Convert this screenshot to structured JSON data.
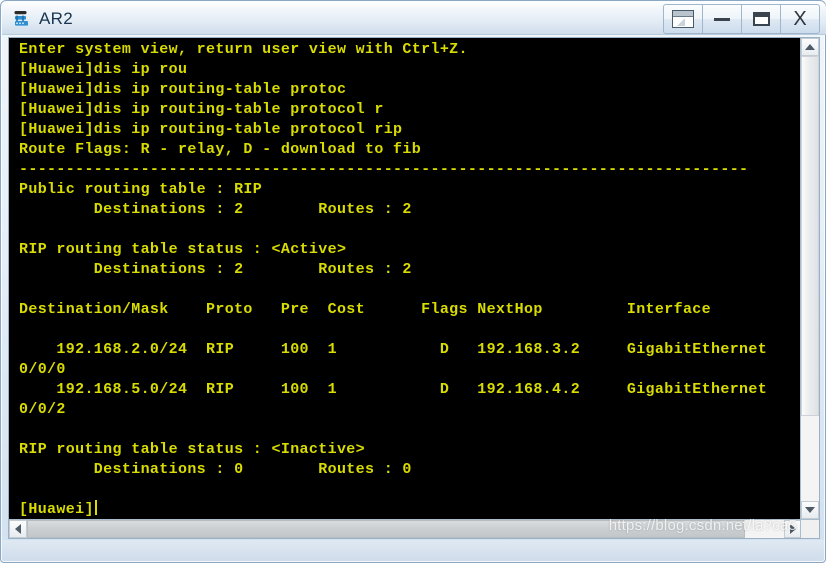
{
  "window": {
    "title": "AR2",
    "icon": "router-icon",
    "controls": [
      {
        "name": "restore-window-button",
        "icon": "restore-icon",
        "label": ""
      },
      {
        "name": "minimize-button",
        "icon": "minimize-icon",
        "label": ""
      },
      {
        "name": "maximize-button",
        "icon": "maximize-icon",
        "label": ""
      },
      {
        "name": "close-button",
        "icon": "close-icon",
        "label": "X"
      }
    ]
  },
  "terminal": {
    "foreground_color": "#d9dc00",
    "background_color": "#000000",
    "lines": [
      "Enter system view, return user view with Ctrl+Z.",
      "[Huawei]dis ip rou",
      "[Huawei]dis ip routing-table protoc",
      "[Huawei]dis ip routing-table protocol r",
      "[Huawei]dis ip routing-table protocol rip",
      "Route Flags: R - relay, D - download to fib",
      "------------------------------------------------------------------------------",
      "Public routing table : RIP",
      "        Destinations : 2        Routes : 2",
      "",
      "RIP routing table status : <Active>",
      "        Destinations : 2        Routes : 2",
      "",
      "Destination/Mask    Proto   Pre  Cost      Flags NextHop         Interface",
      "",
      "    192.168.2.0/24  RIP     100  1           D   192.168.3.2     GigabitEthernet",
      "0/0/0",
      "    192.168.5.0/24  RIP     100  1           D   192.168.4.2     GigabitEthernet",
      "0/0/2",
      "",
      "RIP routing table status : <Inactive>",
      "        Destinations : 0        Routes : 0",
      "",
      "[Huawei]"
    ],
    "prompt": "[Huawei]",
    "cursor_visible": true,
    "routing_table": {
      "headers": [
        "Destination/Mask",
        "Proto",
        "Pre",
        "Cost",
        "Flags",
        "NextHop",
        "Interface"
      ],
      "rows": [
        [
          "192.168.2.0/24",
          "RIP",
          "100",
          "1",
          "D",
          "192.168.3.2",
          "GigabitEthernet0/0/0"
        ],
        [
          "192.168.5.0/24",
          "RIP",
          "100",
          "1",
          "D",
          "192.168.4.2",
          "GigabitEthernet0/0/2"
        ]
      ]
    },
    "summary": {
      "public_table": "RIP",
      "public_destinations": "2",
      "public_routes": "2",
      "active_destinations": "2",
      "active_routes": "2",
      "inactive_destinations": "0",
      "inactive_routes": "0"
    }
  },
  "scrollbars": {
    "vertical": {
      "up_arrow": "chevron-up-icon",
      "down_arrow": "chevron-down-icon"
    },
    "horizontal": {
      "left_arrow": "chevron-left-icon",
      "right_arrow": "chevron-right-icon"
    }
  },
  "watermark": {
    "text": "https://blog.csdn.net/la?ca5"
  }
}
